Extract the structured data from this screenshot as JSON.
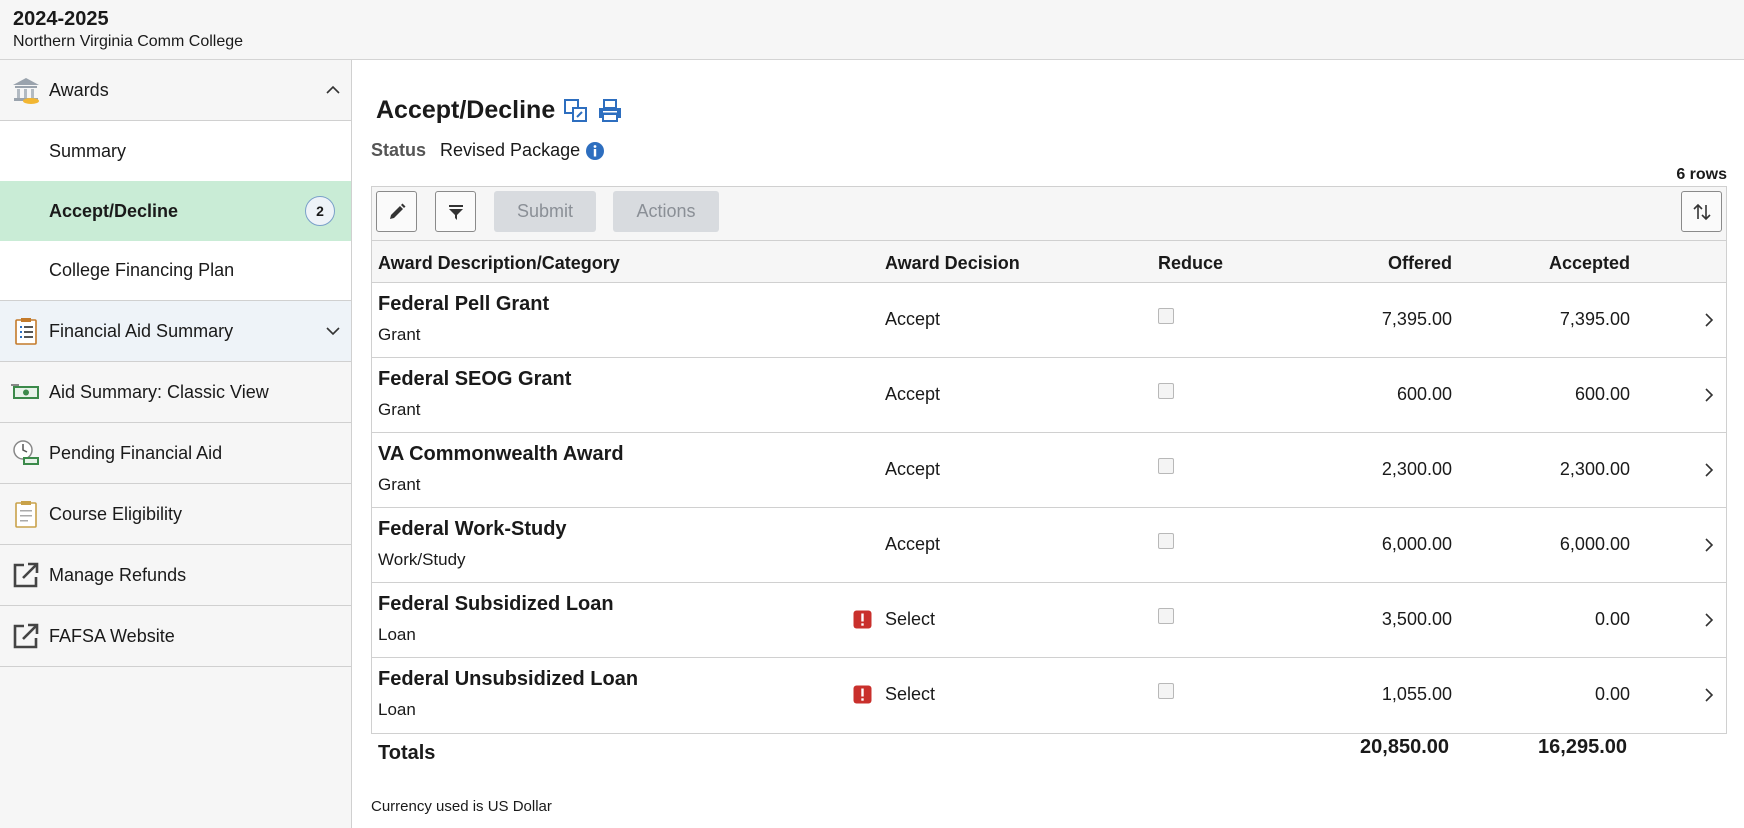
{
  "header": {
    "year": "2024-2025",
    "institution": "Northern Virginia Comm College"
  },
  "sidebar": {
    "awards": {
      "label": "Awards",
      "items": [
        {
          "label": "Summary"
        },
        {
          "label": "Accept/Decline",
          "badge": "2"
        },
        {
          "label": "College Financing Plan"
        }
      ]
    },
    "sections": [
      {
        "label": "Financial Aid Summary"
      },
      {
        "label": "Aid Summary: Classic View"
      },
      {
        "label": "Pending Financial Aid"
      },
      {
        "label": "Course Eligibility"
      },
      {
        "label": "Manage Refunds"
      },
      {
        "label": "FAFSA Website"
      }
    ]
  },
  "main": {
    "title": "Accept/Decline",
    "status_label": "Status",
    "status_value": "Revised Package",
    "rows_count": "6 rows",
    "toolbar": {
      "submit_label": "Submit",
      "actions_label": "Actions"
    },
    "columns": {
      "description": "Award Description/Category",
      "decision": "Award Decision",
      "reduce": "Reduce",
      "offered": "Offered",
      "accepted": "Accepted"
    },
    "rows": [
      {
        "name": "Federal Pell Grant",
        "category": "Grant",
        "decision": "Accept",
        "offered": "7,395.00",
        "accepted": "7,395.00"
      },
      {
        "name": "Federal SEOG Grant",
        "category": "Grant",
        "decision": "Accept",
        "offered": "600.00",
        "accepted": "600.00"
      },
      {
        "name": "VA Commonwealth Award",
        "category": "Grant",
        "decision": "Accept",
        "offered": "2,300.00",
        "accepted": "2,300.00"
      },
      {
        "name": "Federal Work-Study",
        "category": "Work/Study",
        "decision": "Accept",
        "offered": "6,000.00",
        "accepted": "6,000.00"
      },
      {
        "name": "Federal Subsidized Loan",
        "category": "Loan",
        "decision": "Select",
        "offered": "3,500.00",
        "accepted": "0.00"
      },
      {
        "name": "Federal Unsubsidized Loan",
        "category": "Loan",
        "decision": "Select",
        "offered": "1,055.00",
        "accepted": "0.00"
      }
    ],
    "totals": {
      "label": "Totals",
      "offered": "20,850.00",
      "accepted": "16,295.00"
    },
    "currency_note": "Currency used is US Dollar"
  },
  "colors": {
    "active_nav": "#c9ecd6",
    "icon_blue": "#2d6ebf",
    "warning_red": "#c9302c",
    "disabled_button": "#d8dbdf"
  },
  "icons": [
    "bank-icon",
    "clipboard-list-icon",
    "money-icon",
    "clock-money-icon",
    "clipboard-icon",
    "external-link-icon",
    "new-window-icon",
    "print-icon",
    "info-icon",
    "pencil-icon",
    "filter-icon",
    "sort-icon",
    "warning-icon",
    "chevron-right-icon"
  ]
}
